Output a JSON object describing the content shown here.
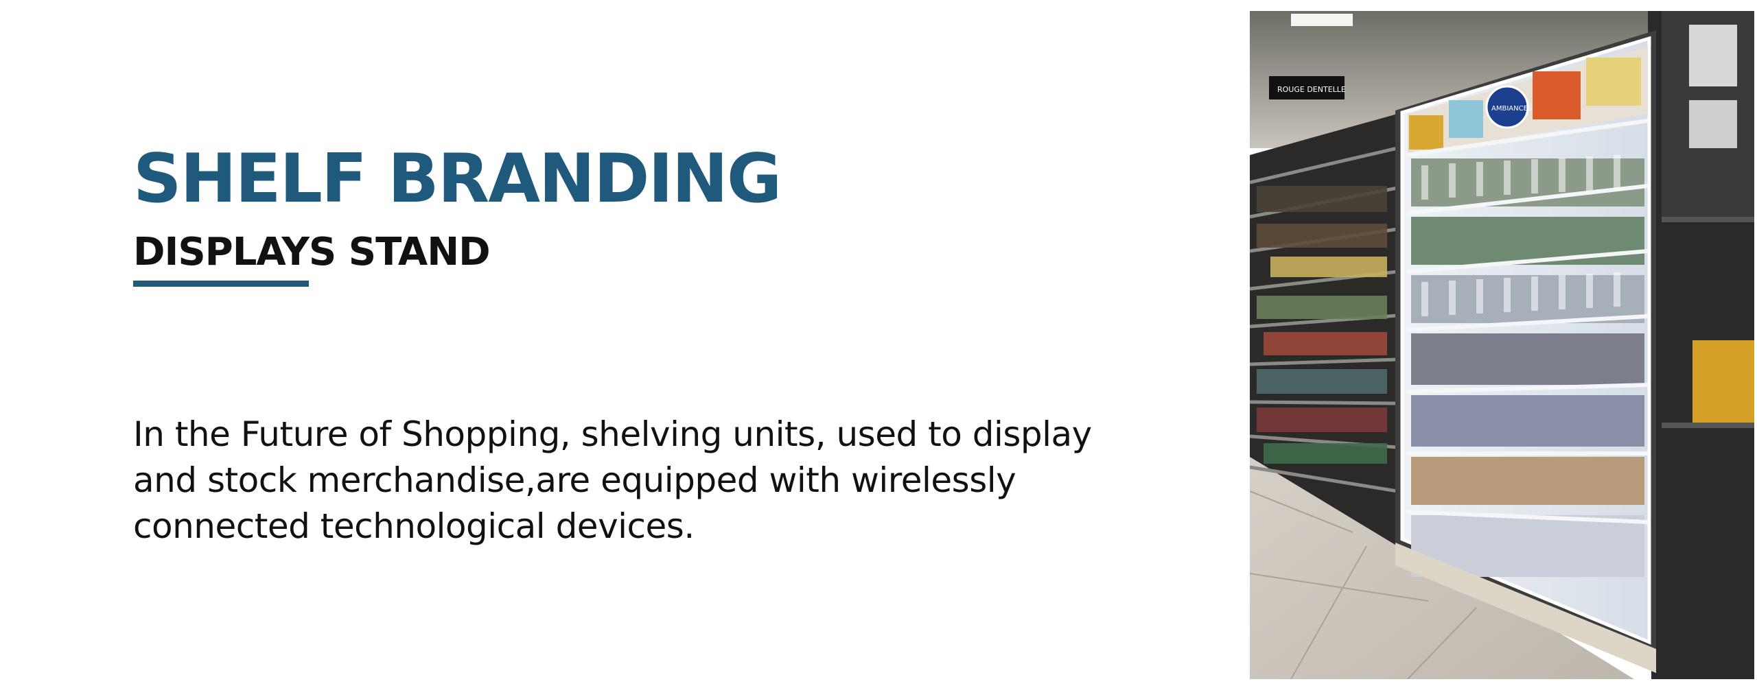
{
  "slide": {
    "title": "SHELF BRANDING",
    "subtitle": "DISPLAYS STAND",
    "body": "In the Future of Shopping, shelving units, used to display and stock merchandise,are equipped with wirelessly connected technological devices.",
    "colors": {
      "accent": "#1f5a7c",
      "text": "#111111",
      "background": "#ffffff"
    }
  },
  "photo": {
    "sign_text": "AMBIANCES",
    "aisle_sign_text": "ROUGE DENTELLE"
  }
}
